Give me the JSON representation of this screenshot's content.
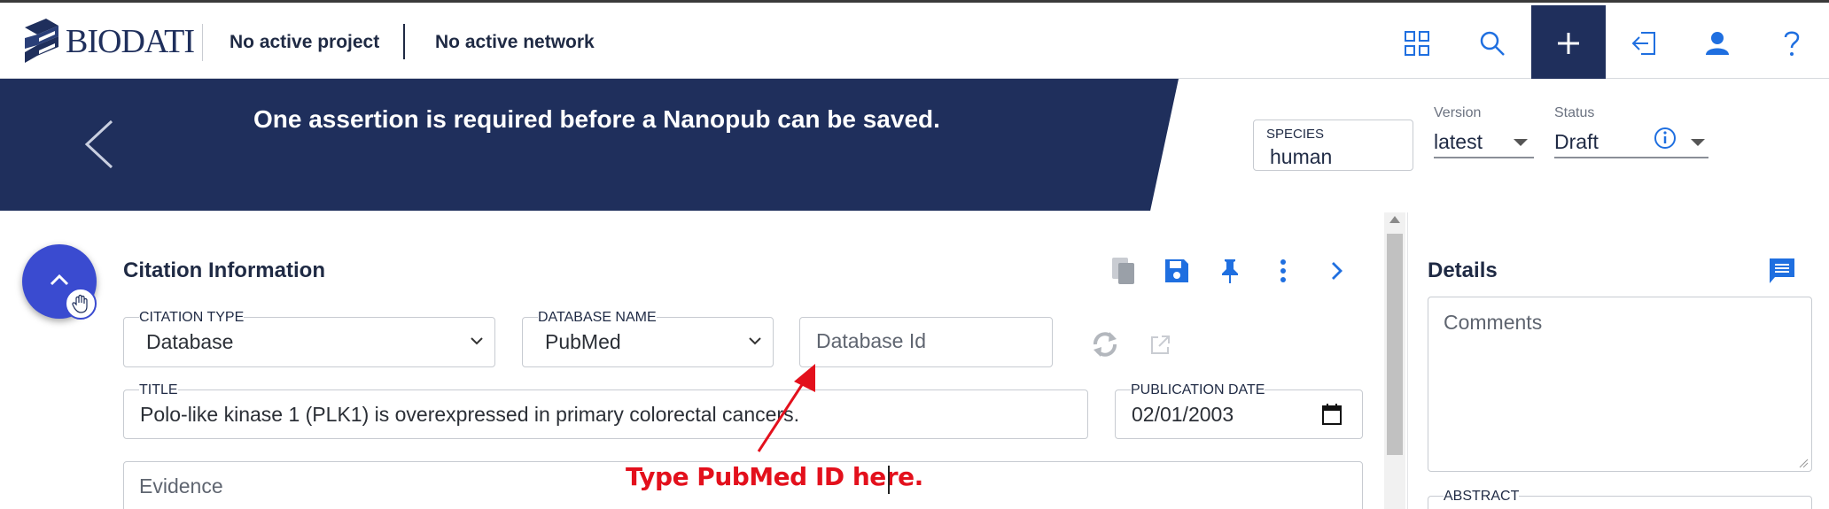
{
  "navbar": {
    "logo_text": "BIODATI",
    "project": "No active project",
    "network": "No active network",
    "icons": [
      "apps-grid-icon",
      "search-icon",
      "plus-icon",
      "import-icon",
      "user-icon",
      "help-icon"
    ]
  },
  "banner": {
    "message": "One assertion is required before a Nanopub can be saved.",
    "species_label": "SPECIES",
    "species_value": "human",
    "version_label": "Version",
    "version_value": "latest",
    "status_label": "Status",
    "status_value": "Draft"
  },
  "citation": {
    "title": "Citation Information",
    "citation_type_label": "CITATION TYPE",
    "citation_type_value": "Database",
    "database_name_label": "DATABASE NAME",
    "database_name_value": "PubMed",
    "database_id_placeholder": "Database Id",
    "title_label": "TITLE",
    "title_value": "Polo-like kinase 1 (PLK1) is overexpressed in primary colorectal cancers.",
    "publication_date_label": "PUBLICATION DATE",
    "publication_date_value": "02/01/2003",
    "evidence_placeholder": "Evidence"
  },
  "details": {
    "title": "Details",
    "comments_placeholder": "Comments",
    "abstract_label": "ABSTRACT"
  },
  "annotation": {
    "text": "Type PubMed ID here."
  },
  "colors": {
    "navy": "#1f2f5c",
    "accent_blue": "#1f6fe0",
    "fab_blue": "#3a4bd0",
    "annotation_red": "#e3101c"
  }
}
